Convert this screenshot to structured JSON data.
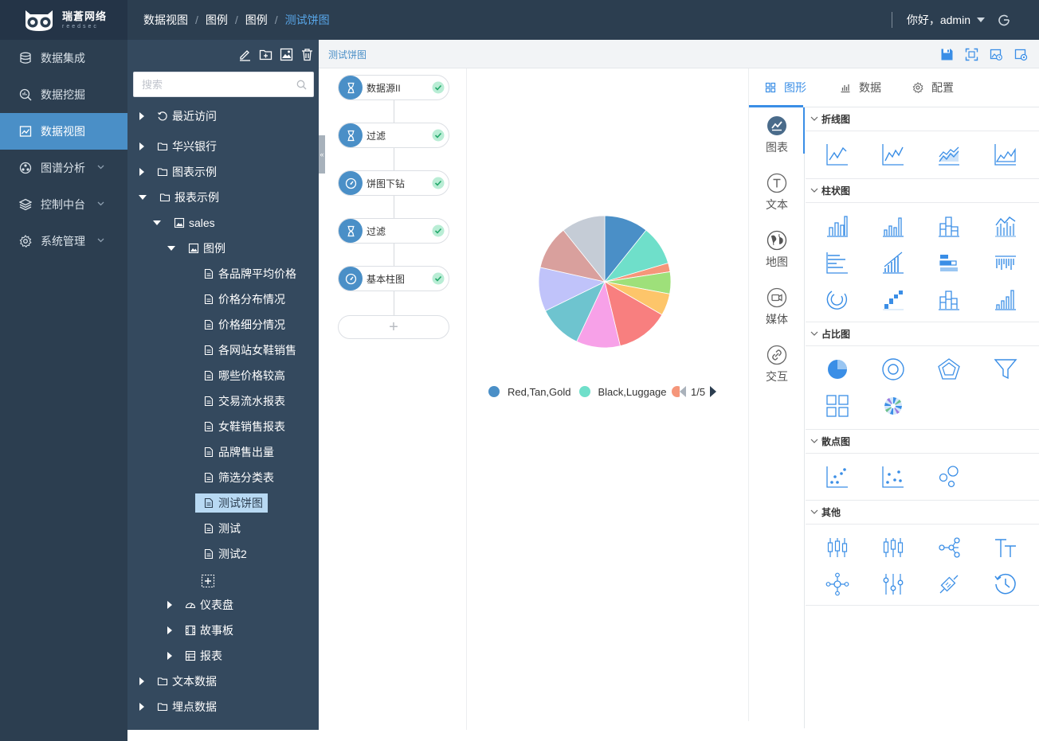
{
  "header": {
    "brand_cn": "瑞蒼网络",
    "brand_en": "reedsec",
    "breadcrumb": [
      "数据视图",
      "图例",
      "图例",
      "测试饼图"
    ],
    "greeting": "你好，admin"
  },
  "nav": {
    "items": [
      {
        "label": "数据集成",
        "icon": "database-icon"
      },
      {
        "label": "数据挖掘",
        "icon": "search-data-icon"
      },
      {
        "label": "数据视图",
        "icon": "image-chart-icon",
        "active": true
      },
      {
        "label": "图谱分析",
        "icon": "graph-icon",
        "has_children": true
      },
      {
        "label": "控制中台",
        "icon": "layers-icon",
        "has_children": true
      },
      {
        "label": "系统管理",
        "icon": "gear-icon",
        "has_children": true
      }
    ]
  },
  "tree": {
    "search_placeholder": "搜索",
    "nodes": [
      {
        "label": "最近访问",
        "icon": "history-icon",
        "expanded": false
      },
      {
        "label": "华兴银行",
        "icon": "folder-icon",
        "expanded": false
      },
      {
        "label": "图表示例",
        "icon": "folder-icon",
        "expanded": false
      },
      {
        "label": "报表示例",
        "icon": "folder-icon",
        "expanded": true
      },
      {
        "label": "sales",
        "icon": "image-icon",
        "expanded": true
      },
      {
        "label": "图例",
        "icon": "image-icon",
        "expanded": true
      },
      {
        "label": "各品牌平均价格",
        "icon": "file-icon"
      },
      {
        "label": "价格分布情况",
        "icon": "file-icon"
      },
      {
        "label": "价格细分情况",
        "icon": "file-icon"
      },
      {
        "label": "各网站女鞋销售",
        "icon": "file-icon"
      },
      {
        "label": "哪些价格较高",
        "icon": "file-icon"
      },
      {
        "label": "交易流水报表",
        "icon": "file-icon"
      },
      {
        "label": "女鞋销售报表",
        "icon": "file-icon"
      },
      {
        "label": "品牌售出量",
        "icon": "file-icon"
      },
      {
        "label": "筛选分类表",
        "icon": "file-icon"
      },
      {
        "label": "测试饼图",
        "icon": "file-icon",
        "selected": true
      },
      {
        "label": "测试",
        "icon": "file-icon"
      },
      {
        "label": "测试2",
        "icon": "file-icon"
      },
      {
        "label": "仪表盘",
        "icon": "dashboard-icon",
        "expanded": false
      },
      {
        "label": "故事板",
        "icon": "film-icon",
        "expanded": false
      },
      {
        "label": "报表",
        "icon": "table-icon",
        "expanded": false
      },
      {
        "label": "文本数据",
        "icon": "folder-icon",
        "expanded": false
      },
      {
        "label": "埋点数据",
        "icon": "folder-icon",
        "expanded": false
      }
    ]
  },
  "workspace": {
    "title": "测试饼图"
  },
  "flow": {
    "steps": [
      {
        "label": "数据源II",
        "icon": "hourglass-icon",
        "status": "ok"
      },
      {
        "label": "过滤",
        "icon": "hourglass-icon",
        "status": "ok"
      },
      {
        "label": "饼图下钻",
        "icon": "gauge-icon",
        "status": "ok"
      },
      {
        "label": "过滤",
        "icon": "hourglass-icon",
        "status": "ok"
      },
      {
        "label": "基本柱图",
        "icon": "gauge-icon",
        "status": "ok"
      }
    ],
    "add_label": "+"
  },
  "chart_data": {
    "type": "pie",
    "title": "",
    "slices": [
      {
        "value": 10,
        "color": "#4a8fc7"
      },
      {
        "value": 9,
        "color": "#6fdfca"
      },
      {
        "value": 2,
        "color": "#f5967a"
      },
      {
        "value": 5,
        "color": "#9ee07a"
      },
      {
        "value": 5,
        "color": "#fdc56a"
      },
      {
        "value": 12,
        "color": "#f87f7f"
      },
      {
        "value": 10,
        "color": "#f7a1e8"
      },
      {
        "value": 10,
        "color": "#6ec4cf"
      },
      {
        "value": 10,
        "color": "#c0c3fa"
      },
      {
        "value": 10,
        "color": "#d9a09d"
      },
      {
        "value": 10,
        "color": "#c5ccd6"
      }
    ],
    "legend": [
      {
        "label": "Red,Tan,Gold",
        "color": "#4a8fc7"
      },
      {
        "label": "Black,Luggage",
        "color": "#6fdfca"
      },
      {
        "label": "",
        "color": "#f5967a"
      }
    ],
    "legend_page": "1/5",
    "legend_position": "bottom"
  },
  "panel": {
    "tabs": [
      {
        "label": "图形",
        "active": true
      },
      {
        "label": "数据"
      },
      {
        "label": "配置"
      }
    ],
    "categories": [
      {
        "label": "图表",
        "active": true
      },
      {
        "label": "文本"
      },
      {
        "label": "地图"
      },
      {
        "label": "媒体"
      },
      {
        "label": "交互"
      }
    ],
    "sections": [
      {
        "label": "折线图",
        "icons": [
          "line-chart-icon",
          "line-chart-2-icon",
          "multi-line-icon",
          "area-line-icon"
        ]
      },
      {
        "label": "柱状图",
        "icons": [
          "bar-chart-icon",
          "bar-chart-2-icon",
          "stacked-bar-icon",
          "bar-line-mix-icon",
          "horizontal-bar-icon",
          "diagonal-bar-icon",
          "progress-bar-icon",
          "barcode-icon",
          "radial-bar-icon",
          "waterfall-icon",
          "stacked-column-icon",
          "rising-bar-icon"
        ]
      },
      {
        "label": "占比图",
        "icons": [
          "pie-chart-icon",
          "ring-chart-icon",
          "radar-chart-icon",
          "funnel-chart-icon",
          "treemap-icon",
          "sunburst-icon"
        ]
      },
      {
        "label": "散点图",
        "icons": [
          "scatter-icon",
          "scatter-2-icon",
          "bubble-icon"
        ]
      },
      {
        "label": "其他",
        "icons": [
          "candlestick-icon",
          "candlestick-2-icon",
          "tree-graph-icon",
          "text-icon",
          "network-icon",
          "sliders-icon",
          "relation-icon",
          "timeline-icon"
        ]
      }
    ],
    "accent_color": "#3a8ee6"
  },
  "colors": {
    "nav_bg": "#2c3e50",
    "tree_bg": "#34495e",
    "active_nav": "#4a8fc7"
  }
}
